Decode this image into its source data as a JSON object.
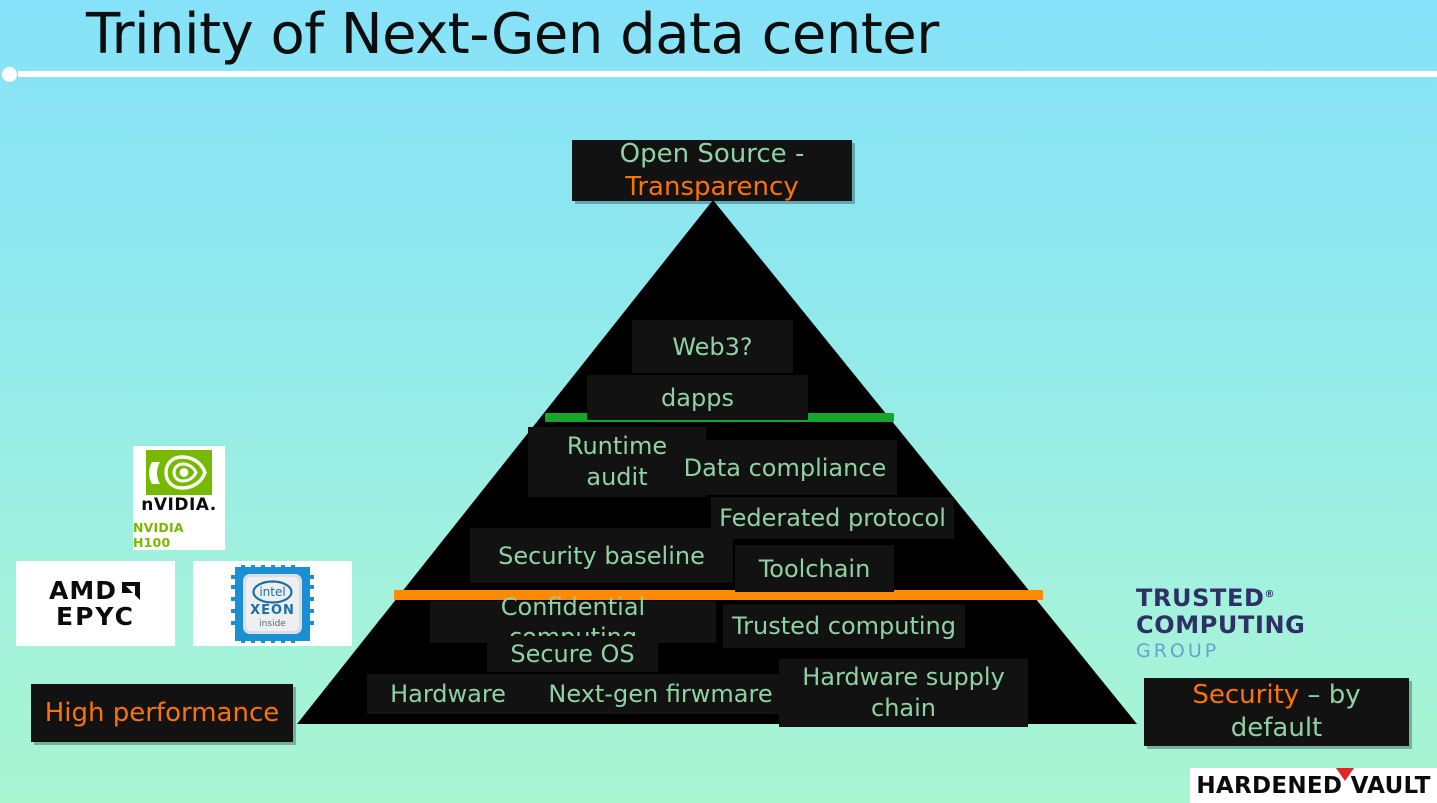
{
  "slide": {
    "title": "Trinity of Next-Gen data center",
    "background_top": "#86E2F8",
    "background_bottom": "#A8F5D2"
  },
  "callouts": {
    "top": {
      "line1": "Open Source -",
      "line2": "Transparency",
      "line1_color": "#8FD2A2",
      "line2_color": "#F97306"
    },
    "left": {
      "text": "High performance",
      "color": "#F97306"
    },
    "right": {
      "accent": "Security",
      "rest": " – by default",
      "accent_color": "#F97306",
      "rest_color": "#8FD2A2"
    }
  },
  "pyramid": {
    "apex_label": "Open Source - Transparency",
    "text_color": "#8FD2A2",
    "body_color": "#000000",
    "layers": [
      {
        "id": "web3",
        "label": "Web3?"
      },
      {
        "id": "dapps",
        "label": "dapps"
      },
      {
        "id": "runtime-audit",
        "label": "Runtime\naudit"
      },
      {
        "id": "data-compliance",
        "label": "Data compliance"
      },
      {
        "id": "federated-protocol",
        "label": "Federated protocol"
      },
      {
        "id": "security-baseline",
        "label": "Security baseline"
      },
      {
        "id": "toolchain",
        "label": "Toolchain"
      },
      {
        "id": "confidential-computing",
        "label": "Confidential computing"
      },
      {
        "id": "trusted-computing",
        "label": "Trusted computing"
      },
      {
        "id": "secure-os",
        "label": "Secure OS"
      },
      {
        "id": "hardware",
        "label": "Hardware"
      },
      {
        "id": "next-gen-firmware",
        "label": "Next-gen firwmare"
      },
      {
        "id": "hardware-supply-chain",
        "label": "Hardware supply\nchain"
      }
    ],
    "dividers": [
      {
        "id": "green-divider",
        "color": "#17A62B"
      },
      {
        "id": "orange-divider",
        "color": "#FF8A07"
      }
    ]
  },
  "logos": {
    "nvidia": {
      "wordmark": "nVIDIA.",
      "caption": "NVIDIA H100",
      "caption_color": "#76B900",
      "eye_color": "#76B900"
    },
    "amd": {
      "line1": "AMD",
      "line2": "EPYC"
    },
    "intel": {
      "brand": "intel",
      "family": "XEON",
      "tagline": "inside"
    },
    "tcg": {
      "line1": "TRUSTED",
      "reg": "®",
      "line2": "COMPUTING",
      "line3": "GROUP",
      "dark_color": "#2E3066",
      "light_color": "#6A9FD4"
    },
    "hardened_vault": {
      "text": "HARDENED VAULT",
      "accent_color": "#E3242B"
    }
  }
}
